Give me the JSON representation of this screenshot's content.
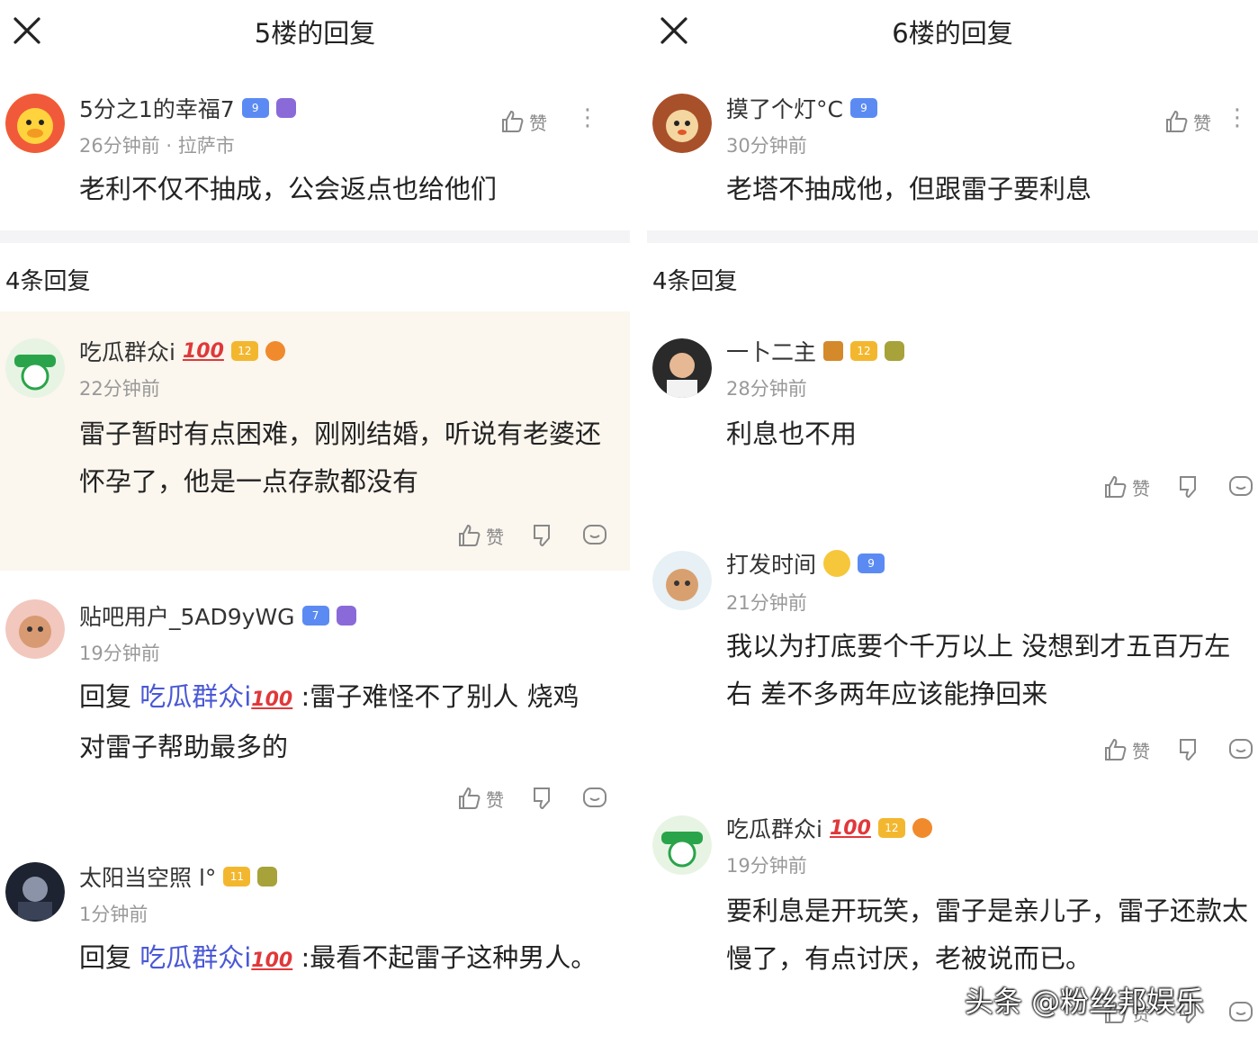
{
  "left": {
    "header": {
      "title": "5楼的回复"
    },
    "post": {
      "user": "5分之1的幸福7",
      "level": "9",
      "time": "26分钟前",
      "location": "拉萨市",
      "text": "老利不仅不抽成，公会返点也给他们",
      "like_label": "赞"
    },
    "count": "4条回复",
    "comments": [
      {
        "user": "吃瓜群众i",
        "badge_text": "100",
        "level": "12",
        "time": "22分钟前",
        "text": "雷子暂时有点困难，刚刚结婚，听说有老婆还怀孕了，他是一点存款都没有",
        "like_label": "赞"
      },
      {
        "user": "贴吧用户_5AD9yWG",
        "level": "7",
        "time": "19分钟前",
        "reply_prefix": "回复",
        "mention": "吃瓜群众i",
        "mention_badge": "100",
        "text": ":雷子难怪不了别人 烧鸡对雷子帮助最多的",
        "like_label": "赞"
      },
      {
        "user": "太阳当空照 l°",
        "level": "11",
        "time": "1分钟前",
        "reply_prefix": "回复",
        "mention": "吃瓜群众i",
        "mention_badge": "100",
        "text": ":最看不起雷子这种男人。"
      }
    ]
  },
  "right": {
    "header": {
      "title": "6楼的回复"
    },
    "post": {
      "user": "摸了个灯°C",
      "level": "9",
      "time": "30分钟前",
      "text": "老塔不抽成他，但跟雷子要利息",
      "like_label": "赞"
    },
    "count": "4条回复",
    "comments": [
      {
        "user": "一卜二主",
        "level": "12",
        "time": "28分钟前",
        "text": "利息也不用",
        "like_label": "赞"
      },
      {
        "user": "打发时间",
        "level": "9",
        "time": "21分钟前",
        "text": "我以为打底要个千万以上 没想到才五百万左右 差不多两年应该能挣回来",
        "like_label": "赞"
      },
      {
        "user": "吃瓜群众i",
        "badge_text": "100",
        "level": "12",
        "time": "19分钟前",
        "text": "要利息是开玩笑，雷子是亲儿子，雷子还款太慢了，有点讨厌，老被说而已。",
        "like_label": "赞"
      }
    ]
  },
  "watermark": "头条 @粉丝邦娱乐",
  "colors": {
    "mention": "#4a58d6",
    "highlight_bg": "#fbf6ee",
    "separator": "#f4f4f6"
  }
}
